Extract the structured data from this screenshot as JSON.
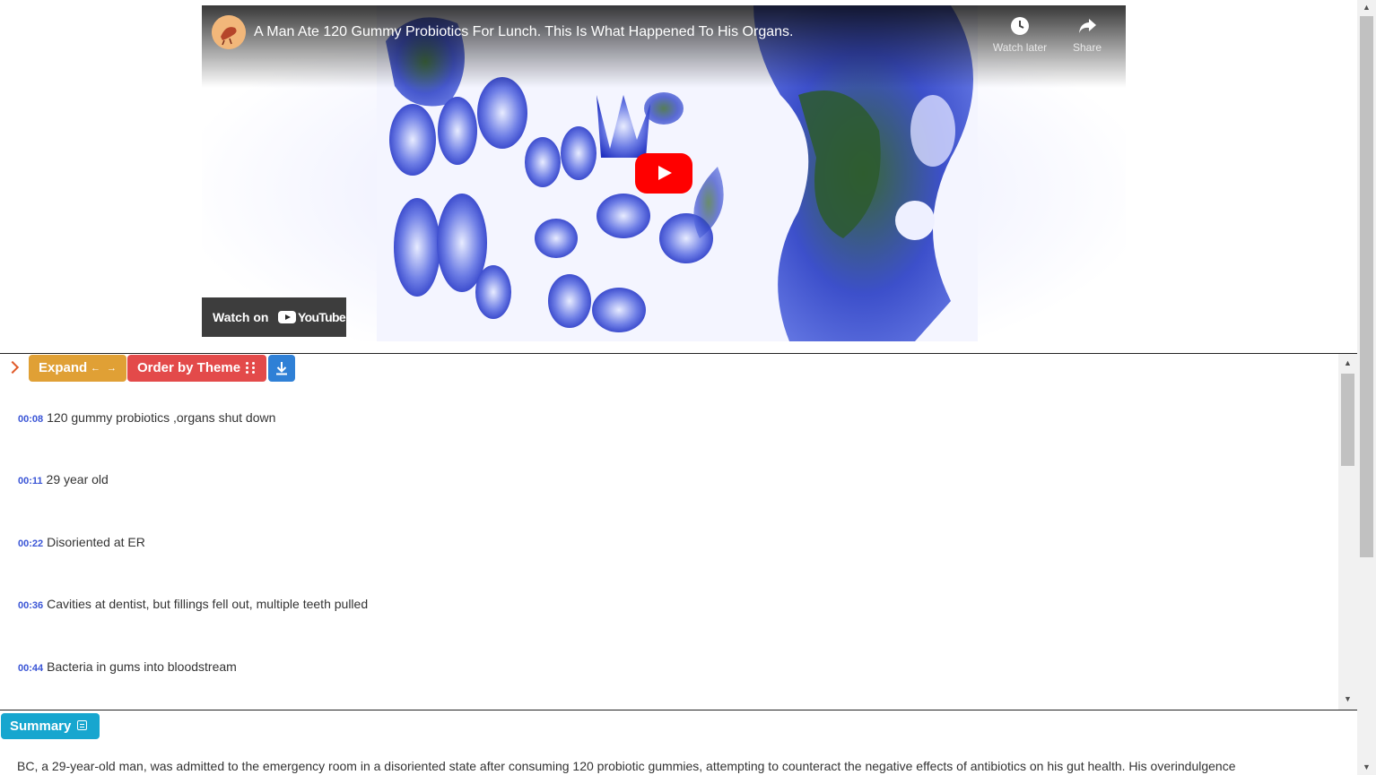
{
  "video": {
    "title": "A Man Ate 120 Gummy Probiotics For Lunch. This Is What Happened To His Organs.",
    "watch_later_label": "Watch later",
    "share_label": "Share",
    "watch_on_label": "Watch on",
    "youtube_label": "YouTube"
  },
  "toolbar": {
    "expand_label": "Expand",
    "expand_icon": "left-right-arrows-icon",
    "order_label": "Order by Theme",
    "order_icon": "drag-dots-icon",
    "download_icon": "download-icon"
  },
  "transcript": [
    {
      "time": "00:08",
      "text": "120 gummy probiotics ,organs shut down"
    },
    {
      "time": "00:11",
      "text": "29 year old"
    },
    {
      "time": "00:22",
      "text": "Disoriented at ER"
    },
    {
      "time": "00:36",
      "text": "Cavities at dentist, but fillings fell out, multiple teeth pulled"
    },
    {
      "time": "00:44",
      "text": "Bacteria in gums into bloodstream"
    }
  ],
  "summary": {
    "label": "Summary",
    "icon": "calendar-list-icon",
    "text": "BC, a 29-year-old man, was admitted to the emergency room in a disoriented state after consuming 120 probiotic gummies, attempting to counteract the negative effects of antibiotics on his gut health. His overindulgence"
  },
  "colors": {
    "expand": "#e0a035",
    "order": "#e34a4a",
    "download": "#2f80d6",
    "summary": "#17a6cf",
    "timestamp": "#3a55d6",
    "play_button": "#ff0000"
  }
}
